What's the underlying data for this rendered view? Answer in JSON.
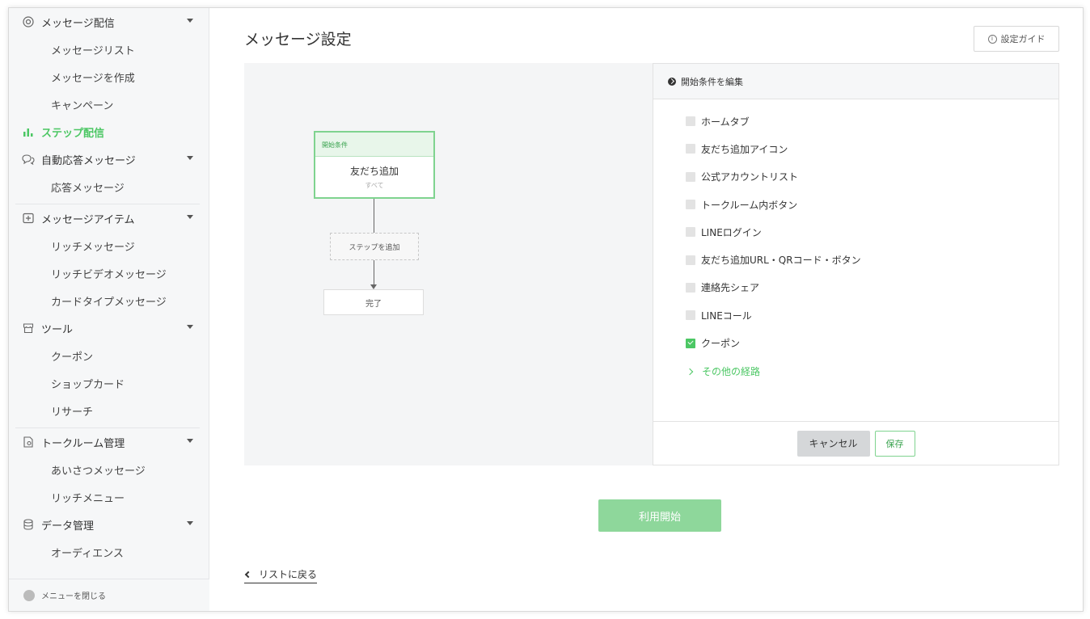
{
  "sidebar": {
    "groups": [
      {
        "label": "メッセージ配信",
        "icon": "broadcast-icon",
        "items": [
          "メッセージリスト",
          "メッセージを作成",
          "キャンペーン"
        ]
      },
      {
        "label": "ステップ配信",
        "icon": "bar-chart-icon",
        "active": true
      },
      {
        "label": "自動応答メッセージ",
        "icon": "chat-bubbles-icon",
        "items": [
          "応答メッセージ"
        ]
      },
      {
        "label": "メッセージアイテム",
        "icon": "message-item-icon",
        "items": [
          "リッチメッセージ",
          "リッチビデオメッセージ",
          "カードタイプメッセージ"
        ]
      },
      {
        "label": "ツール",
        "icon": "store-icon",
        "items": [
          "クーポン",
          "ショップカード",
          "リサーチ"
        ]
      },
      {
        "label": "トークルーム管理",
        "icon": "talk-room-icon",
        "items": [
          "あいさつメッセージ",
          "リッチメニュー"
        ]
      },
      {
        "label": "データ管理",
        "icon": "database-icon",
        "items": [
          "オーディエンス"
        ]
      }
    ],
    "footer": "メニューを閉じる"
  },
  "header": {
    "title": "メッセージ設定",
    "guide_label": "設定ガイド"
  },
  "flow": {
    "start_header": "開始条件",
    "start_title": "友だち追加",
    "start_sub": "すべて",
    "add_step": "ステップを追加",
    "end": "完了"
  },
  "panel": {
    "title": "開始条件を編集",
    "options": [
      {
        "label": "ホームタブ",
        "checked": false
      },
      {
        "label": "友だち追加アイコン",
        "checked": false
      },
      {
        "label": "公式アカウントリスト",
        "checked": false
      },
      {
        "label": "トークルーム内ボタン",
        "checked": false
      },
      {
        "label": "LINEログイン",
        "checked": false
      },
      {
        "label": "友だち追加URL・QRコード・ボタン",
        "checked": false
      },
      {
        "label": "連絡先シェア",
        "checked": false
      },
      {
        "label": "LINEコール",
        "checked": false
      },
      {
        "label": "クーポン",
        "checked": true
      }
    ],
    "more_label": "その他の経路",
    "cancel_label": "キャンセル",
    "save_label": "保存"
  },
  "actions": {
    "start_label": "利用開始",
    "back_label": "リストに戻る"
  },
  "colors": {
    "accent": "#4cc764",
    "accent_light": "#8ed79b",
    "sidebar_bg": "#f6f7f8",
    "canvas_bg": "#f4f5f6"
  }
}
